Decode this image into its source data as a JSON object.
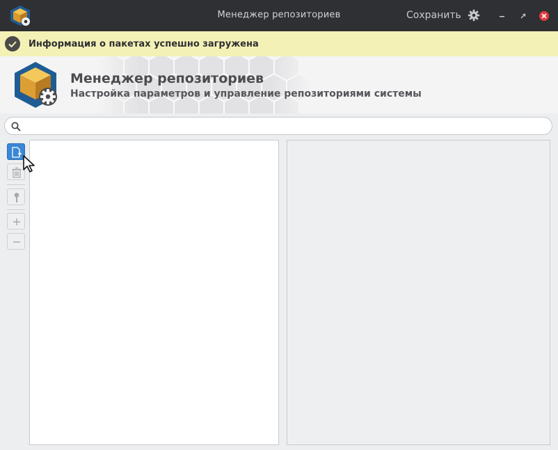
{
  "window": {
    "title": "Менеджер репозиториев",
    "save_label": "Сохранить",
    "icons": {
      "app": "package-gear-icon",
      "settings": "gear-icon",
      "minimize": "minimize-icon",
      "maximize": "maximize-icon",
      "close": "close-icon"
    },
    "colors": {
      "titlebar": "#2f3033",
      "close": "#e0393e"
    }
  },
  "infobar": {
    "text": "Информация о пакетах успешно загружена",
    "icon": "checkmark-icon",
    "color": "#f4f1b7"
  },
  "header": {
    "title": "Менеджер репозиториев",
    "subtitle": "Настройка параметров и управление репозиториями системы",
    "logo": "package-gear-icon"
  },
  "search": {
    "value": "",
    "placeholder": "",
    "icon": "search-icon"
  },
  "toolbar": {
    "items": [
      {
        "name": "add-repository-button",
        "icon": "add-document-icon",
        "active": true
      },
      {
        "name": "delete-button",
        "icon": "trash-icon",
        "active": false
      },
      {
        "name": "key-button",
        "icon": "key-icon",
        "active": false
      },
      {
        "name": "expand-button",
        "icon": "plus-icon",
        "active": false
      },
      {
        "name": "collapse-button",
        "icon": "minus-icon",
        "active": false
      }
    ],
    "accent": "#3b86d6"
  }
}
